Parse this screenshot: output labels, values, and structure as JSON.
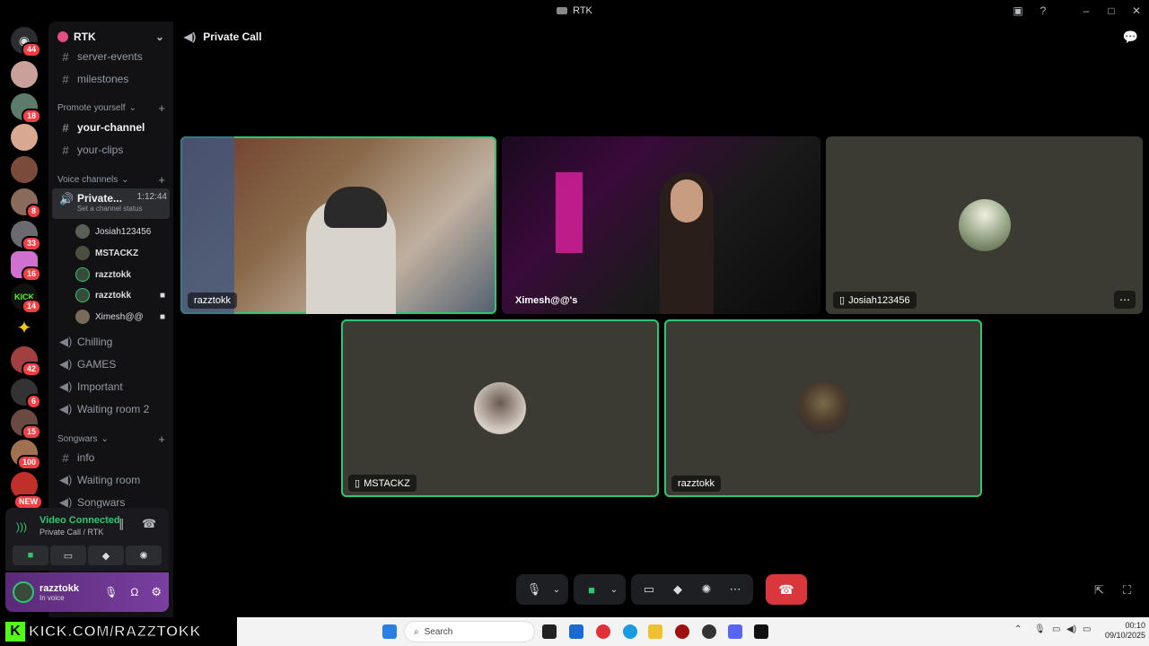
{
  "window": {
    "title": "RTK"
  },
  "guild_badges": [
    "44",
    "18",
    "8",
    "33",
    "16",
    "14",
    "42",
    "6",
    "15",
    "100",
    "NEW"
  ],
  "sidebar": {
    "server_name": "RTK",
    "channels_top": [
      {
        "name": "server-events",
        "icon": "hash"
      },
      {
        "name": "milestones",
        "icon": "hash"
      }
    ],
    "cat_promote": "Promote yourself",
    "channels_promote": [
      {
        "name": "your-channel",
        "icon": "hash"
      },
      {
        "name": "your-clips",
        "icon": "hash"
      }
    ],
    "cat_voice": "Voice channels",
    "active_voice": {
      "name": "Private...",
      "timer": "1:12:44",
      "status_hint": "Set a channel status"
    },
    "voice_users": [
      "Josiah123456",
      "MSTACKZ",
      "razztokk",
      "razztokk",
      "Ximesh@@"
    ],
    "voice_channels": [
      "Chilling",
      "GAMES",
      "Important",
      "Waiting room 2"
    ],
    "cat_songwars": "Songwars",
    "channels_songwars": [
      "info",
      "Waiting room",
      "Songwars"
    ],
    "vc_status": "Video Connected",
    "vc_sub": "Private Call / RTK",
    "user_name": "razztokk",
    "user_status": "In voice"
  },
  "main": {
    "channel_title": "Private Call",
    "tiles": [
      {
        "name": "razztokk",
        "type": "video"
      },
      {
        "name": "Ximesh@@'s",
        "type": "video"
      },
      {
        "name": "Josiah123456",
        "type": "avatar",
        "mobile": true
      },
      {
        "name": "MSTACKZ",
        "type": "avatar",
        "mobile": true
      },
      {
        "name": "razztokk",
        "type": "avatar"
      }
    ]
  },
  "taskbar": {
    "search_placeholder": "Search",
    "time": "00:10",
    "date": "09/10/2025",
    "kick_banner": "KICK.COM/RAZZTOKK"
  }
}
